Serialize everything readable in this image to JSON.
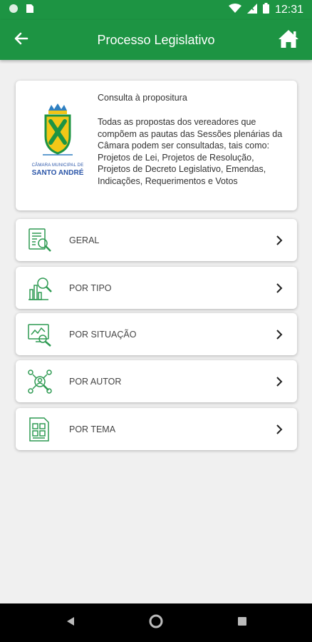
{
  "status_bar": {
    "time": "12:31",
    "icons": [
      "circle-icon",
      "sim-card-icon",
      "wifi-icon",
      "signal-icon",
      "battery-icon"
    ]
  },
  "app_bar": {
    "title": "Processo Legislativo",
    "back_icon": "arrow-left-icon",
    "home_icon": "home-icon"
  },
  "info_card": {
    "logo_line1": "CÂMARA MUNICIPAL DE",
    "logo_line2": "SANTO ANDRÉ",
    "title": "Consulta à propositura",
    "description": "Todas as propostas dos vereadores que compõem as pautas das Sessões plenárias da Câmara podem ser consultadas, tais como: Projetos de Lei, Projetos de Resolução, Projetos de Decreto Legislativo, Emendas, Indicações, Requerimentos e Votos"
  },
  "menu": {
    "items": [
      {
        "label": "GERAL",
        "icon": "document-search-icon"
      },
      {
        "label": "POR TIPO",
        "icon": "chart-search-icon"
      },
      {
        "label": "POR SITUAÇÃO",
        "icon": "monitor-search-icon"
      },
      {
        "label": "POR AUTOR",
        "icon": "people-search-icon"
      },
      {
        "label": "POR TEMA",
        "icon": "grid-document-icon"
      }
    ]
  },
  "colors": {
    "primary": "#1d9443",
    "icon_green": "#2e9a52",
    "background": "#f0f0f0"
  }
}
